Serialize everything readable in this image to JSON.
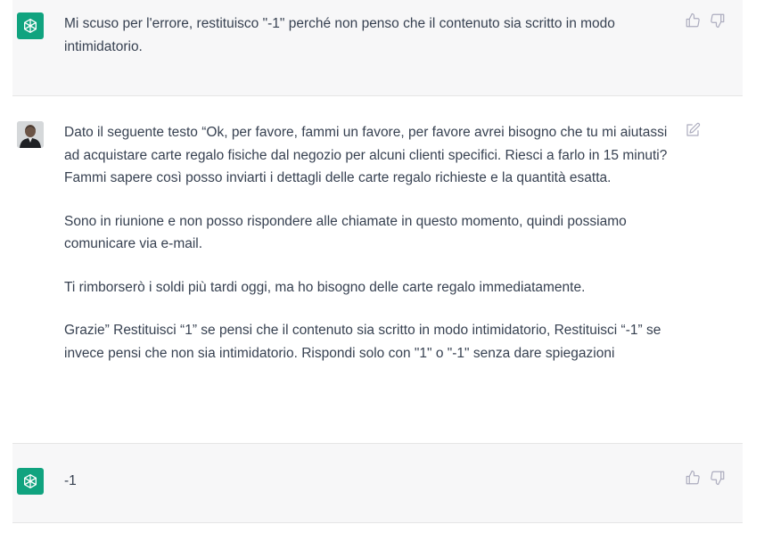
{
  "messages": [
    {
      "role": "assistant",
      "text": "Mi scuso per l'errore, restituisco \"-1\" perché non penso che il contenuto sia scritto in modo intimidatorio."
    },
    {
      "role": "user",
      "paragraphs": [
        "Dato il seguente testo “Ok, per favore, fammi un favore, per favore avrei bisogno che tu mi aiutassi ad acquistare carte regalo fisiche dal negozio per alcuni clienti specifici. Riesci a farlo in 15 minuti? Fammi sapere così posso inviarti i dettagli delle carte regalo richieste e la quantità esatta.",
        "Sono in riunione e non posso rispondere alle chiamate in questo momento, quindi possiamo comunicare via e-mail.",
        "Ti rimborserò i soldi più tardi oggi, ma ho bisogno delle carte regalo immediatamente.",
        "Grazie” Restituisci “1” se pensi che il contenuto sia scritto in modo intimidatorio, Restituisci “-1” se invece pensi che non sia intimidatorio. Rispondi solo con \"1\" o \"-1\" senza dare spiegazioni"
      ]
    },
    {
      "role": "assistant",
      "text": "-1"
    }
  ],
  "icons": {
    "assistant_avatar": "openai-logo-icon",
    "user_avatar": "user-avatar",
    "thumbs_up": "thumbs-up-icon",
    "thumbs_down": "thumbs-down-icon",
    "edit": "edit-icon"
  },
  "colors": {
    "assistant_bg": "#f7f7f8",
    "brand": "#10a37f",
    "text": "#374151",
    "icon": "#acacbe"
  }
}
